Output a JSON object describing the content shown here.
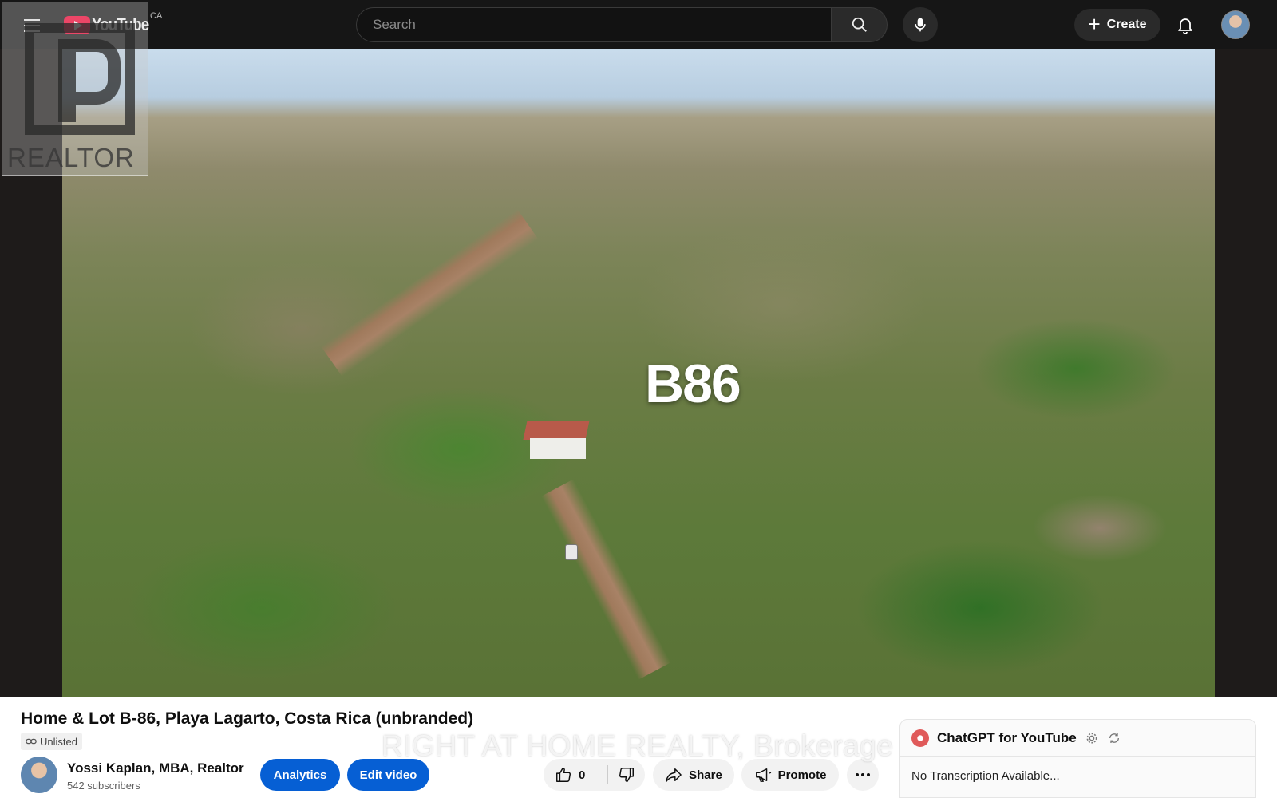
{
  "header": {
    "logo_text": "YouTube",
    "region": "CA",
    "search_placeholder": "Search",
    "create_label": "Create",
    "icons": [
      "menu-icon",
      "search-icon",
      "mic-icon",
      "plus-icon",
      "bell-icon"
    ]
  },
  "video": {
    "overlay_text": "B86",
    "watermark_logo_text": "REALTOR",
    "watermark_brokerage": "RIGHT AT HOME REALTY, Brokerage"
  },
  "details": {
    "title": "Home & Lot B-86, Playa Lagarto, Costa Rica (unbranded)",
    "visibility": "Unlisted",
    "channel_name": "Yossi Kaplan, MBA, Realtor",
    "subscribers": "542 subscribers"
  },
  "actions": {
    "analytics": "Analytics",
    "edit_video": "Edit video",
    "like_count": "0",
    "share": "Share",
    "promote": "Promote"
  },
  "extension": {
    "title": "ChatGPT for YouTube",
    "message": "No Transcription Available..."
  },
  "colors": {
    "topbar": "#161616",
    "brand_red": "#ff0033",
    "accent_blue": "#065fd4"
  }
}
